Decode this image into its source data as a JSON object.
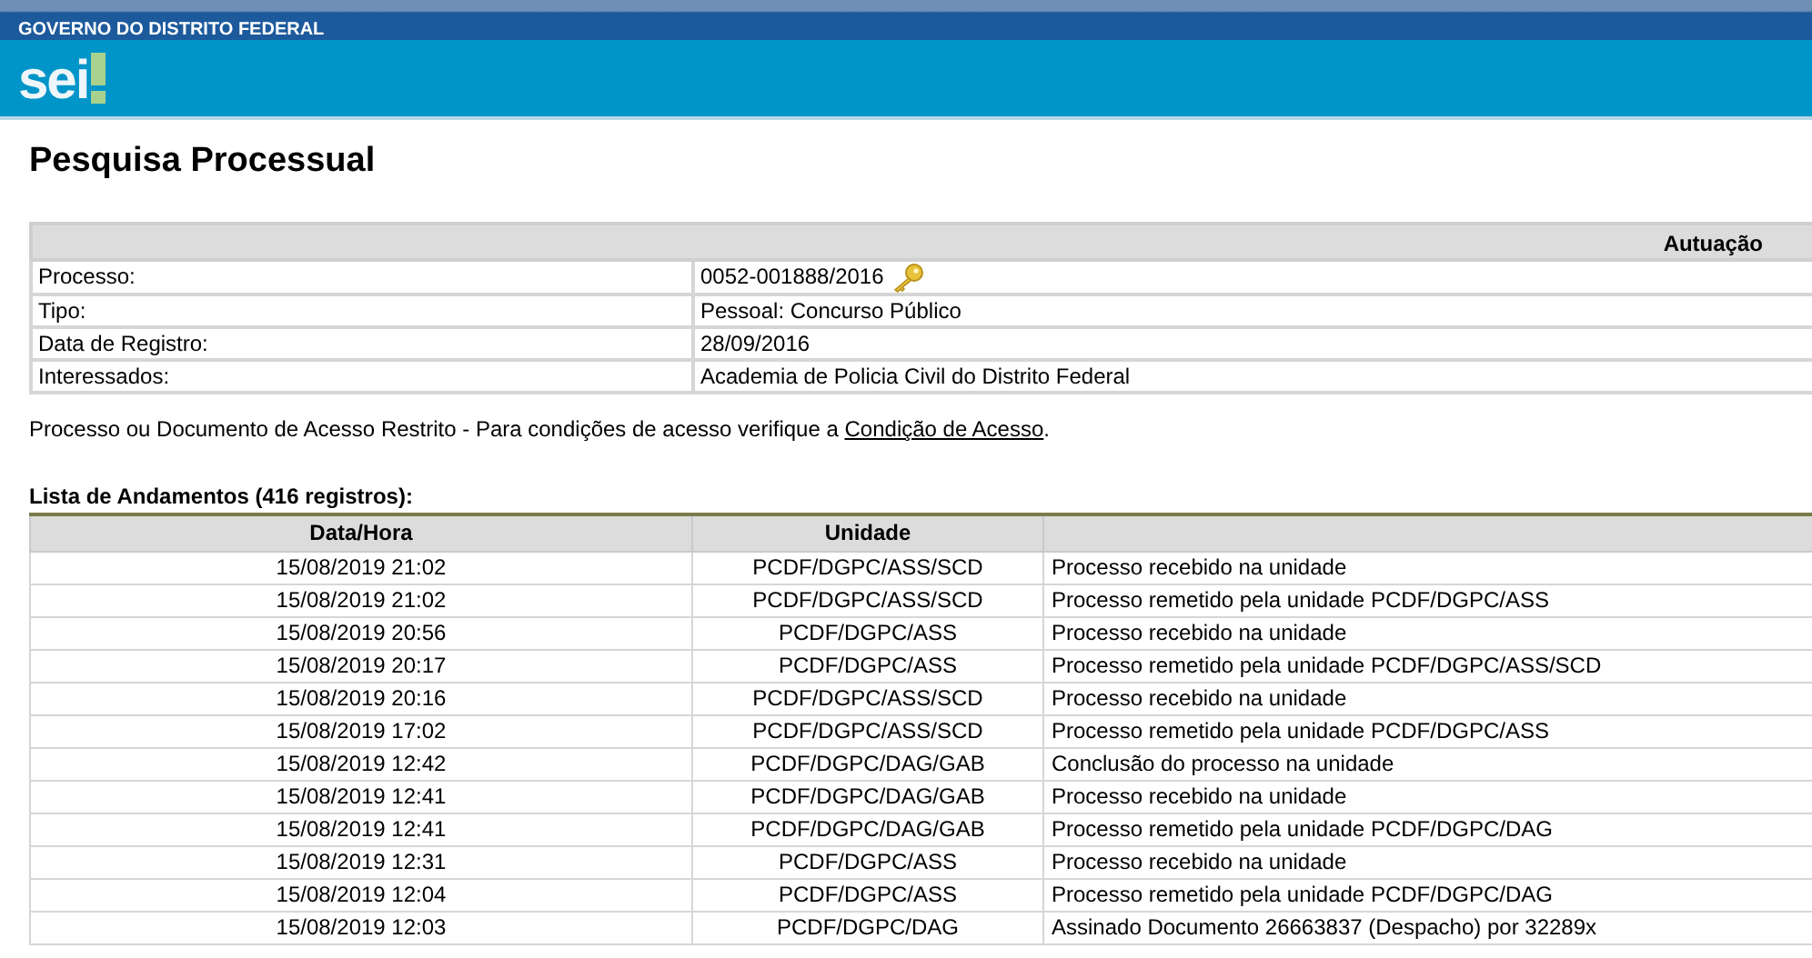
{
  "header": {
    "government": "GOVERNO DO DISTRITO FEDERAL",
    "logo": "sei"
  },
  "title": "Pesquisa Processual",
  "autuacao": {
    "heading": "Autuação",
    "fields": [
      {
        "label": "Processo:",
        "value": "0052-001888/2016",
        "restricted": true
      },
      {
        "label": "Tipo:",
        "value": "Pessoal: Concurso Público",
        "restricted": false
      },
      {
        "label": "Data de Registro:",
        "value": "28/09/2016",
        "restricted": false
      },
      {
        "label": "Interessados:",
        "value": "Academia de Policia Civil do Distrito Federal",
        "restricted": false
      }
    ]
  },
  "notice": {
    "text": "Processo ou Documento de Acesso Restrito - Para condições de acesso verifique a ",
    "link": "Condição de Acesso",
    "end": "."
  },
  "andamentos": {
    "caption": "Lista de Andamentos (416 registros):",
    "columns": [
      "Data/Hora",
      "Unidade"
    ],
    "rows": [
      [
        "15/08/2019 21:02",
        "PCDF/DGPC/ASS/SCD",
        "Processo recebido na unidade"
      ],
      [
        "15/08/2019 21:02",
        "PCDF/DGPC/ASS/SCD",
        "Processo remetido pela unidade PCDF/DGPC/ASS"
      ],
      [
        "15/08/2019 20:56",
        "PCDF/DGPC/ASS",
        "Processo recebido na unidade"
      ],
      [
        "15/08/2019 20:17",
        "PCDF/DGPC/ASS",
        "Processo remetido pela unidade PCDF/DGPC/ASS/SCD"
      ],
      [
        "15/08/2019 20:16",
        "PCDF/DGPC/ASS/SCD",
        "Processo recebido na unidade"
      ],
      [
        "15/08/2019 17:02",
        "PCDF/DGPC/ASS/SCD",
        "Processo remetido pela unidade PCDF/DGPC/ASS"
      ],
      [
        "15/08/2019 12:42",
        "PCDF/DGPC/DAG/GAB",
        "Conclusão do processo na unidade"
      ],
      [
        "15/08/2019 12:41",
        "PCDF/DGPC/DAG/GAB",
        "Processo recebido na unidade"
      ],
      [
        "15/08/2019 12:41",
        "PCDF/DGPC/DAG/GAB",
        "Processo remetido pela unidade PCDF/DGPC/DAG"
      ],
      [
        "15/08/2019 12:31",
        "PCDF/DGPC/ASS",
        "Processo recebido na unidade"
      ],
      [
        "15/08/2019 12:04",
        "PCDF/DGPC/ASS",
        "Processo remetido pela unidade PCDF/DGPC/DAG"
      ],
      [
        "15/08/2019 12:03",
        "PCDF/DGPC/DAG",
        "Assinado Documento 26663837 (Despacho) por 32289x"
      ]
    ]
  }
}
